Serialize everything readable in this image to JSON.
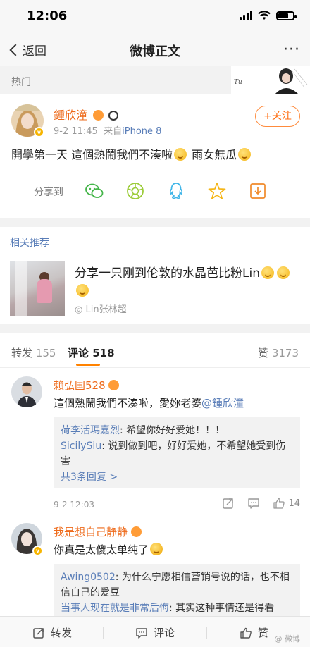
{
  "status": {
    "time": "12:06"
  },
  "nav": {
    "back_label": "返回",
    "title": "微博正文",
    "more_label": "···"
  },
  "hot": {
    "label": "热门",
    "banner_text": "Tu"
  },
  "post": {
    "username": "鍾欣潼",
    "time": "9-2 11:45",
    "source_prefix": "来自",
    "source": "iPhone 8",
    "follow_label": "+关注",
    "text_part1": "開學第一天 這個熱鬧我們不湊啦",
    "text_part2": " 雨女無瓜",
    "share_label": "分享到",
    "share_icons": [
      "wechat-icon",
      "moments-icon",
      "qq-icon",
      "qzone-icon",
      "save-image-icon"
    ]
  },
  "recommend": {
    "header": "相关推荐",
    "title": "分享一只刚到伦敦的水晶芭比粉Lin",
    "user": "◎ Lin张林超"
  },
  "tabs": {
    "repost_label": "转发",
    "repost_count": "155",
    "comment_label": "评论",
    "comment_count": "518",
    "like_label": "赞",
    "like_count": "3173"
  },
  "comments": [
    {
      "username": "赖弘国528",
      "text": "這個熱鬧我們不湊啦，愛妳老婆",
      "mention": "@鍾欣潼",
      "replies": [
        {
          "name": "荷李活瑪嘉烈",
          "text": ": 希望你好好爱她！！！"
        },
        {
          "name": "SicilySiu",
          "text": ": 说到做到吧，好好爱她，不希望她受到伤害"
        }
      ],
      "more_replies": "共3条回复 >",
      "time": "9-2 12:03",
      "likes": "14"
    },
    {
      "username": "我是想自己静静",
      "text": "你真是太傻太单纯了",
      "replies": [
        {
          "name": "Awing0502",
          "text": ": 为什么宁愿相信营销号说的话，也不相信自己的爱豆"
        },
        {
          "name": "当事人现在就是非常后悔",
          "text": ": 其实这种事情还是得看"
        }
      ]
    }
  ],
  "bottom": {
    "repost": "转发",
    "comment": "评论",
    "like": "赞",
    "watermark": "@ 微博"
  },
  "colors": {
    "accent": "#ff8200",
    "username": "#ee6a1a",
    "link": "#5a7eb8"
  }
}
